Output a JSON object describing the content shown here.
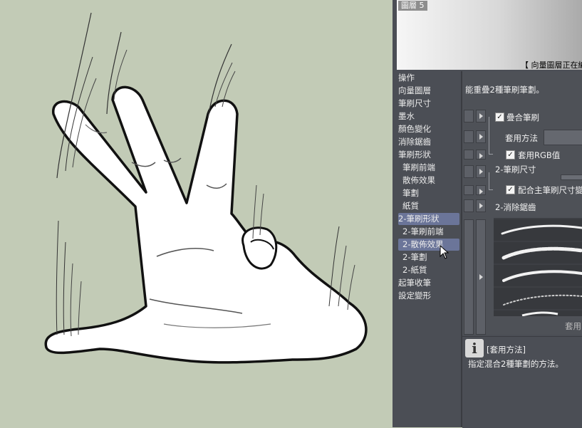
{
  "preview": {
    "layer_name": "圖層 5",
    "status": "【 向量圖層正在編"
  },
  "categories": [
    {
      "label": "操作",
      "sub": false,
      "selected": false
    },
    {
      "label": "向量圖層",
      "sub": false,
      "selected": false
    },
    {
      "label": "筆刷尺寸",
      "sub": false,
      "selected": false
    },
    {
      "label": "墨水",
      "sub": false,
      "selected": false
    },
    {
      "label": "顏色變化",
      "sub": false,
      "selected": false
    },
    {
      "label": "消除鋸齒",
      "sub": false,
      "selected": false
    },
    {
      "label": "筆刷形狀",
      "sub": false,
      "selected": false
    },
    {
      "label": "筆刷前端",
      "sub": true,
      "selected": false
    },
    {
      "label": "散佈效果",
      "sub": true,
      "selected": false
    },
    {
      "label": "筆劃",
      "sub": true,
      "selected": false
    },
    {
      "label": "紙質",
      "sub": true,
      "selected": false
    },
    {
      "label": "2-筆刷形狀",
      "sub": false,
      "selected": true
    },
    {
      "label": "2-筆刷前端",
      "sub": true,
      "selected": false
    },
    {
      "label": "2-散佈效果",
      "sub": true,
      "selected": true
    },
    {
      "label": "2-筆劃",
      "sub": true,
      "selected": false
    },
    {
      "label": "2-紙質",
      "sub": true,
      "selected": false
    },
    {
      "label": "起筆收筆",
      "sub": false,
      "selected": false
    },
    {
      "label": "設定變形",
      "sub": false,
      "selected": false
    }
  ],
  "settings": {
    "description": "能重疊2種筆刷筆劃。",
    "overlay_brush_label": "疊合筆刷",
    "overlay_brush_checked": true,
    "blend_method_label": "套用方法",
    "apply_rgb_label": "套用RGB值",
    "apply_rgb_checked": true,
    "brush2_size_label": "2-筆刷尺寸",
    "match_main_size_label": "配合主筆刷尺寸變",
    "match_main_size_checked": true,
    "brush2_antialias_label": "2-消除鋸齒",
    "apply_button_label": "套用"
  },
  "help": {
    "title": "[套用方法]",
    "text": "指定混合2種筆劃的方法。"
  },
  "colors": {
    "canvas_bg": "#c2cbb6",
    "panel_bg": "#4b4e55",
    "selection": "#6b7599"
  }
}
